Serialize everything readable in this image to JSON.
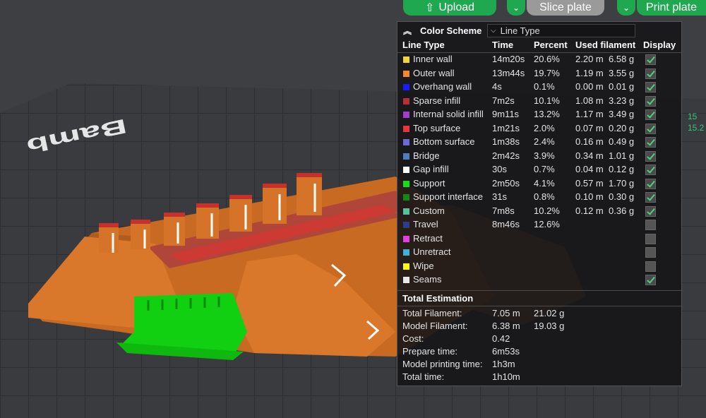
{
  "toolbar": {
    "upload_label": "Upload",
    "slice_label": "Slice plate",
    "print_label": "Print plate"
  },
  "plate_logo_text": "Bamb",
  "legend": {
    "title": "Color Scheme",
    "scheme_value": "Line Type",
    "headers": {
      "line_type": "Line Type",
      "time": "Time",
      "percent": "Percent",
      "used_filament": "Used filament",
      "display": "Display"
    },
    "rows": [
      {
        "name": "Inner wall",
        "time": "14m20s",
        "percent": "20.6%",
        "length": "2.20 m",
        "weight": "6.58 g",
        "color": "#f5d33a",
        "display": true
      },
      {
        "name": "Outer wall",
        "time": "13m44s",
        "percent": "19.7%",
        "length": "1.19 m",
        "weight": "3.55 g",
        "color": "#f08a2a",
        "display": true
      },
      {
        "name": "Overhang wall",
        "time": "4s",
        "percent": "0.1%",
        "length": "0.00 m",
        "weight": "0.01 g",
        "color": "#1a1aff",
        "display": true
      },
      {
        "name": "Sparse infill",
        "time": "7m2s",
        "percent": "10.1%",
        "length": "1.08 m",
        "weight": "3.23 g",
        "color": "#b5313a",
        "display": true
      },
      {
        "name": "Internal solid infill",
        "time": "9m11s",
        "percent": "13.2%",
        "length": "1.17 m",
        "weight": "3.49 g",
        "color": "#a040c8",
        "display": true
      },
      {
        "name": "Top surface",
        "time": "1m21s",
        "percent": "2.0%",
        "length": "0.07 m",
        "weight": "0.20 g",
        "color": "#e6353b",
        "display": true
      },
      {
        "name": "Bottom surface",
        "time": "1m38s",
        "percent": "2.4%",
        "length": "0.16 m",
        "weight": "0.49 g",
        "color": "#6b6bd8",
        "display": true
      },
      {
        "name": "Bridge",
        "time": "2m42s",
        "percent": "3.9%",
        "length": "0.34 m",
        "weight": "1.01 g",
        "color": "#4d7fb8",
        "display": true
      },
      {
        "name": "Gap infill",
        "time": "30s",
        "percent": "0.7%",
        "length": "0.04 m",
        "weight": "0.12 g",
        "color": "#ffffff",
        "display": true
      },
      {
        "name": "Support",
        "time": "2m50s",
        "percent": "4.1%",
        "length": "0.57 m",
        "weight": "1.70 g",
        "color": "#11e011",
        "display": true
      },
      {
        "name": "Support interface",
        "time": "31s",
        "percent": "0.8%",
        "length": "0.10 m",
        "weight": "0.30 g",
        "color": "#118a11",
        "display": true
      },
      {
        "name": "Custom",
        "time": "7m8s",
        "percent": "10.2%",
        "length": "0.12 m",
        "weight": "0.36 g",
        "color": "#55c49a",
        "display": true
      },
      {
        "name": "Travel",
        "time": "8m46s",
        "percent": "12.6%",
        "length": "",
        "weight": "",
        "color": "#2c3e8a",
        "display": false
      },
      {
        "name": "Retract",
        "time": "",
        "percent": "",
        "length": "",
        "weight": "",
        "color": "#e040e0",
        "display": false
      },
      {
        "name": "Unretract",
        "time": "",
        "percent": "",
        "length": "",
        "weight": "",
        "color": "#40b0d8",
        "display": false
      },
      {
        "name": "Wipe",
        "time": "",
        "percent": "",
        "length": "",
        "weight": "",
        "color": "#ffff00",
        "display": false
      },
      {
        "name": "Seams",
        "time": "",
        "percent": "",
        "length": "",
        "weight": "",
        "color": "#e8e8e8",
        "display": true
      }
    ]
  },
  "estimation": {
    "title": "Total Estimation",
    "rows": [
      {
        "label": "Total Filament:",
        "value": "7.05 m",
        "extra": "21.02 g"
      },
      {
        "label": "Model Filament:",
        "value": "6.38 m",
        "extra": "19.03 g"
      },
      {
        "label": "Cost:",
        "value": "0.42",
        "extra": ""
      },
      {
        "label": "Prepare time:",
        "value": "6m53s",
        "extra": ""
      },
      {
        "label": "Model printing time:",
        "value": "1h3m",
        "extra": ""
      },
      {
        "label": "Total time:",
        "value": "1h10m",
        "extra": ""
      }
    ]
  },
  "side_readout": {
    "top": "15",
    "bottom": "15.2"
  },
  "colors": {
    "accent_green": "#1fa84f",
    "model_orange": "#d9772a",
    "support_green": "#11d011"
  }
}
